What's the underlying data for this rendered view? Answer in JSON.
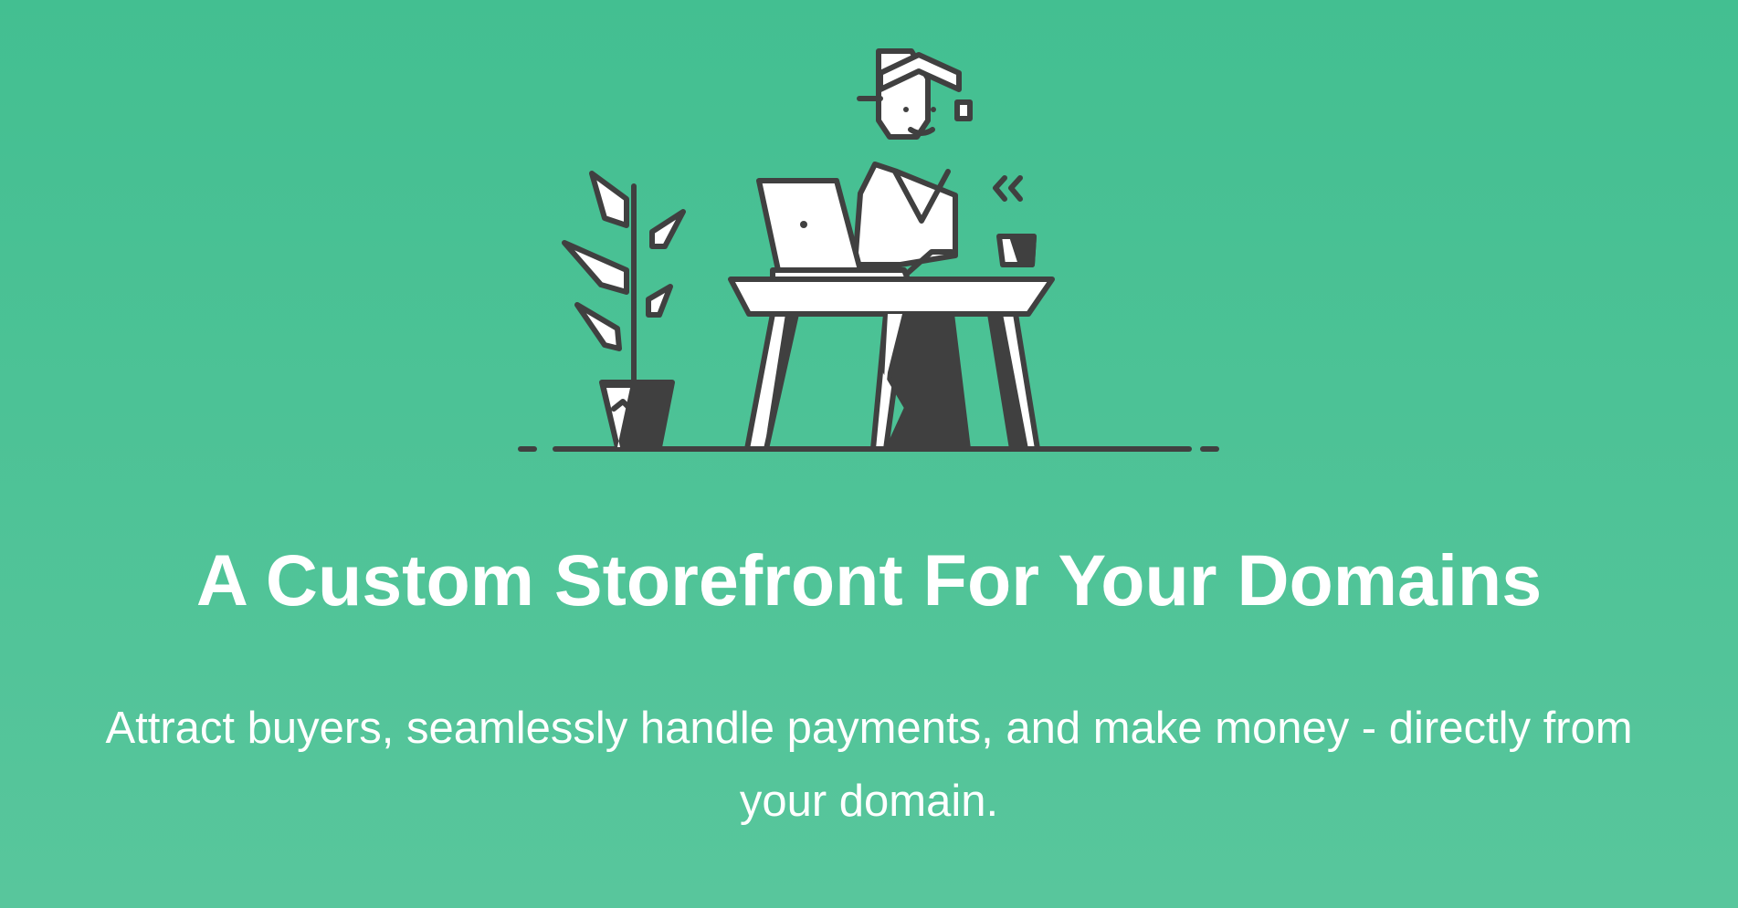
{
  "hero": {
    "illustration_icon": "person-working-at-desk-illustration",
    "title": "A Custom Storefront For Your Domains",
    "subtitle": "Attract buyers, seamlessly handle payments, and make money - directly from your domain."
  },
  "colors": {
    "background_top": "#43bf91",
    "background_bottom": "#58c69c",
    "ink": "#404040",
    "text": "#ffffff"
  }
}
